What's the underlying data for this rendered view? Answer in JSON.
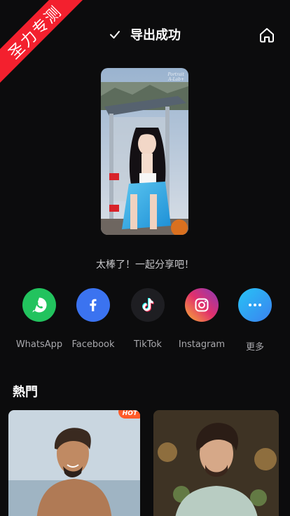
{
  "ribbon": {
    "text": "圣力专测",
    "color": "#f3202e"
  },
  "header": {
    "title": "导出成功",
    "check_icon": "check-icon",
    "home_icon": "home-icon"
  },
  "preview": {
    "watermark_line1": "Portrait",
    "watermark_line2": "A-Lab+"
  },
  "share": {
    "caption": "太棒了！一起分享吧！",
    "items": [
      {
        "label": "WhatsApp",
        "icon": "whatsapp-icon",
        "color": "#22c35e"
      },
      {
        "label": "Facebook",
        "icon": "facebook-icon",
        "color": "#3b73f0"
      },
      {
        "label": "TikTok",
        "icon": "tiktok-icon",
        "color": "#1e1e22"
      },
      {
        "label": "Instagram",
        "icon": "instagram-icon",
        "color": "#c13584"
      },
      {
        "label": "更多",
        "icon": "more-icon",
        "color": "#2f9ff5"
      }
    ]
  },
  "trending": {
    "title": "熱門",
    "badge": "HOT"
  }
}
